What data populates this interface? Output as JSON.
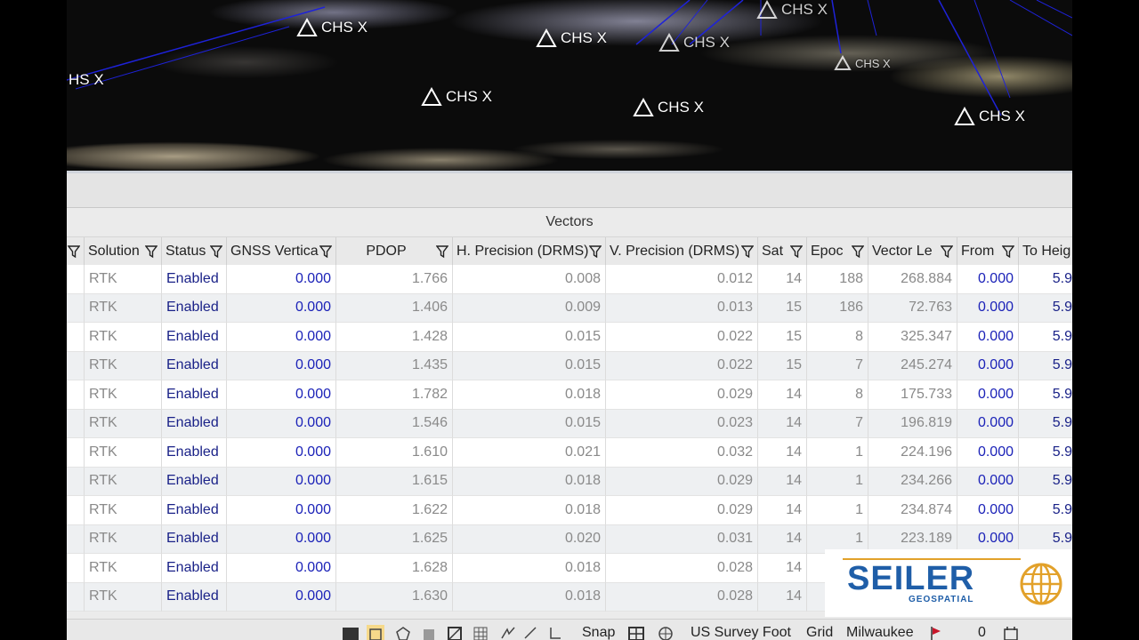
{
  "viewport": {
    "markers": [
      {
        "label": "HS X",
        "show_triangle": false
      },
      {
        "label": "CHS X",
        "show_triangle": true
      },
      {
        "label": "CHS X",
        "show_triangle": true
      },
      {
        "label": "CHS X",
        "show_triangle": true
      },
      {
        "label": "CHS X",
        "show_triangle": true
      },
      {
        "label": "CHS X",
        "show_triangle": true
      },
      {
        "label": "CHS X",
        "show_triangle": true
      },
      {
        "label": "CHS X",
        "show_triangle": true
      },
      {
        "label": "CHS X",
        "show_triangle": true
      }
    ]
  },
  "table": {
    "group_title": "Vectors",
    "columns": [
      "",
      "Solution",
      "Status",
      "GNSS Vertica",
      "PDOP",
      "H. Precision (DRMS)",
      "V. Precision (DRMS)",
      "Sat",
      "Epoc",
      "Vector Le",
      "From",
      "To Heig"
    ],
    "rows": [
      [
        "RTK",
        "Enabled",
        "0.000",
        "1.766",
        "0.008",
        "0.012",
        "14",
        "188",
        "268.884",
        "0.000",
        "5.9"
      ],
      [
        "RTK",
        "Enabled",
        "0.000",
        "1.406",
        "0.009",
        "0.013",
        "15",
        "186",
        "72.763",
        "0.000",
        "5.9"
      ],
      [
        "RTK",
        "Enabled",
        "0.000",
        "1.428",
        "0.015",
        "0.022",
        "15",
        "8",
        "325.347",
        "0.000",
        "5.9"
      ],
      [
        "RTK",
        "Enabled",
        "0.000",
        "1.435",
        "0.015",
        "0.022",
        "15",
        "7",
        "245.274",
        "0.000",
        "5.9"
      ],
      [
        "RTK",
        "Enabled",
        "0.000",
        "1.782",
        "0.018",
        "0.029",
        "14",
        "8",
        "175.733",
        "0.000",
        "5.9"
      ],
      [
        "RTK",
        "Enabled",
        "0.000",
        "1.546",
        "0.015",
        "0.023",
        "14",
        "7",
        "196.819",
        "0.000",
        "5.9"
      ],
      [
        "RTK",
        "Enabled",
        "0.000",
        "1.610",
        "0.021",
        "0.032",
        "14",
        "1",
        "224.196",
        "0.000",
        "5.9"
      ],
      [
        "RTK",
        "Enabled",
        "0.000",
        "1.615",
        "0.018",
        "0.029",
        "14",
        "1",
        "234.266",
        "0.000",
        "5.9"
      ],
      [
        "RTK",
        "Enabled",
        "0.000",
        "1.622",
        "0.018",
        "0.029",
        "14",
        "1",
        "234.874",
        "0.000",
        "5.9"
      ],
      [
        "RTK",
        "Enabled",
        "0.000",
        "1.625",
        "0.020",
        "0.031",
        "14",
        "1",
        "223.189",
        "0.000",
        "5.9"
      ],
      [
        "RTK",
        "Enabled",
        "0.000",
        "1.628",
        "0.018",
        "0.028",
        "14",
        "",
        "",
        "",
        ""
      ],
      [
        "RTK",
        "Enabled",
        "0.000",
        "1.630",
        "0.018",
        "0.028",
        "14",
        "",
        "",
        "",
        ""
      ]
    ]
  },
  "logo": {
    "name": "SEILER",
    "tagline": "GEOSPATIAL"
  },
  "statusbar": {
    "snap": "Snap",
    "units": "US Survey Foot",
    "grid": "Grid",
    "location": "Milwaukee",
    "count": "0"
  },
  "colors": {
    "value_blue": "#1b22b8",
    "link_navy": "#1a2288",
    "logo_blue": "#1f5ea8",
    "logo_gold": "#e2a12a"
  }
}
